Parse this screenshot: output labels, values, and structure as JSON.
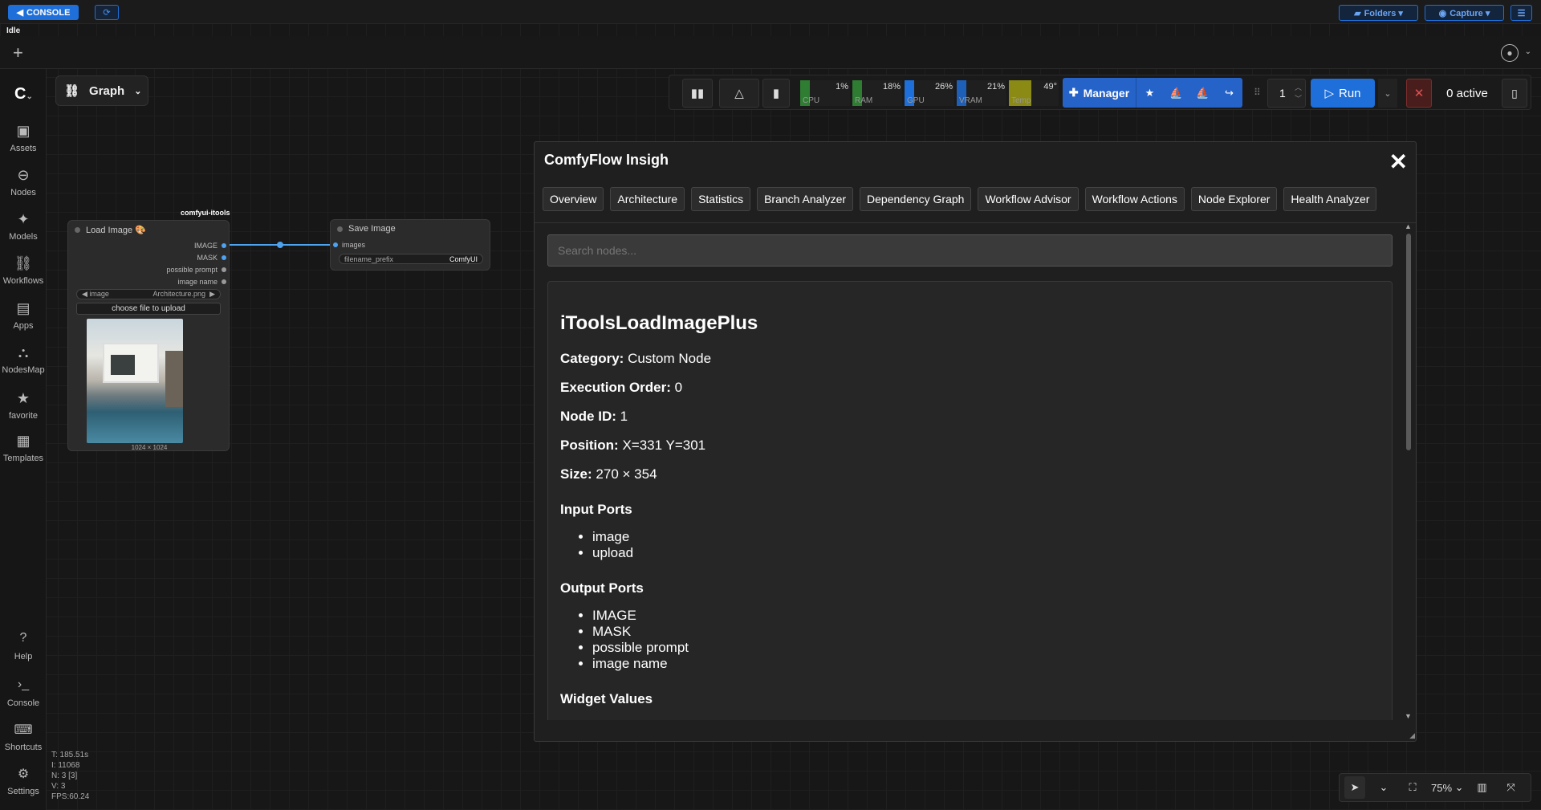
{
  "topbar": {
    "console_label": "CONSOLE",
    "folders_label": "Folders ▾",
    "capture_label": "Capture ▾",
    "status": "Idle"
  },
  "graph_chip": {
    "label": "Graph"
  },
  "sidebar": {
    "items": [
      {
        "label": "Assets",
        "icon": "assets-icon"
      },
      {
        "label": "Nodes",
        "icon": "nodes-icon"
      },
      {
        "label": "Models",
        "icon": "models-icon"
      },
      {
        "label": "Workflows",
        "icon": "workflows-icon"
      },
      {
        "label": "Apps",
        "icon": "apps-icon"
      },
      {
        "label": "NodesMap",
        "icon": "nodesmap-icon"
      },
      {
        "label": "favorite",
        "icon": "star-icon"
      },
      {
        "label": "Templates",
        "icon": "templates-icon"
      }
    ],
    "bottom_items": [
      {
        "label": "Help",
        "icon": "help-icon"
      },
      {
        "label": "Console",
        "icon": "console-icon"
      },
      {
        "label": "Shortcuts",
        "icon": "keyboard-icon"
      },
      {
        "label": "Settings",
        "icon": "gear-icon"
      }
    ]
  },
  "stats": {
    "t": "T: 185.51s",
    "i": "I: 11068",
    "n": "N: 3 [3]",
    "v": "V: 3",
    "fps": "FPS:60.24"
  },
  "toolbar": {
    "meters": [
      {
        "label": "CPU",
        "value": "1%",
        "color": "#2e7d32"
      },
      {
        "label": "RAM",
        "value": "18%",
        "color": "#2e7d32"
      },
      {
        "label": "GPU",
        "value": "26%",
        "color": "#1e6fd9"
      },
      {
        "label": "VRAM",
        "value": "21%",
        "color": "#1e5fb8"
      },
      {
        "label": "Temp",
        "value": "49°",
        "color": "#8a8a14"
      }
    ],
    "manager_label": "Manager",
    "queue_count": "1",
    "run_label": "Run",
    "active_label": "0 active"
  },
  "nodes": {
    "load_image": {
      "badge": "comfyui-itools",
      "title": "Load Image 🎨",
      "outputs": [
        "IMAGE",
        "MASK",
        "possible prompt",
        "image name"
      ],
      "widget_label": "image",
      "widget_value": "Architecture.png",
      "upload_label": "choose file to upload",
      "dims": "1024 × 1024"
    },
    "save_image": {
      "title": "Save Image",
      "input": "images",
      "widget_label": "filename_prefix",
      "widget_value": "ComfyUI"
    }
  },
  "modal": {
    "title": "ComfyFlow Insigh",
    "tabs": [
      "Overview",
      "Architecture",
      "Statistics",
      "Branch Analyzer",
      "Dependency Graph",
      "Workflow Advisor",
      "Workflow Actions",
      "Node Explorer",
      "Health Analyzer"
    ],
    "search_placeholder": "Search nodes...",
    "node": {
      "name": "iToolsLoadImagePlus",
      "category_label": "Category:",
      "category": "Custom Node",
      "order_label": "Execution Order:",
      "order": "0",
      "id_label": "Node ID:",
      "id": "1",
      "position_label": "Position:",
      "position": "X=331 Y=301",
      "size_label": "Size:",
      "size": "270 × 354",
      "inputs_heading": "Input Ports",
      "inputs": [
        "image",
        "upload"
      ],
      "outputs_heading": "Output Ports",
      "outputs": [
        "IMAGE",
        "MASK",
        "possible prompt",
        "image name"
      ],
      "widgets_heading": "Widget Values"
    }
  },
  "canvas_controls": {
    "zoom": "75%"
  }
}
